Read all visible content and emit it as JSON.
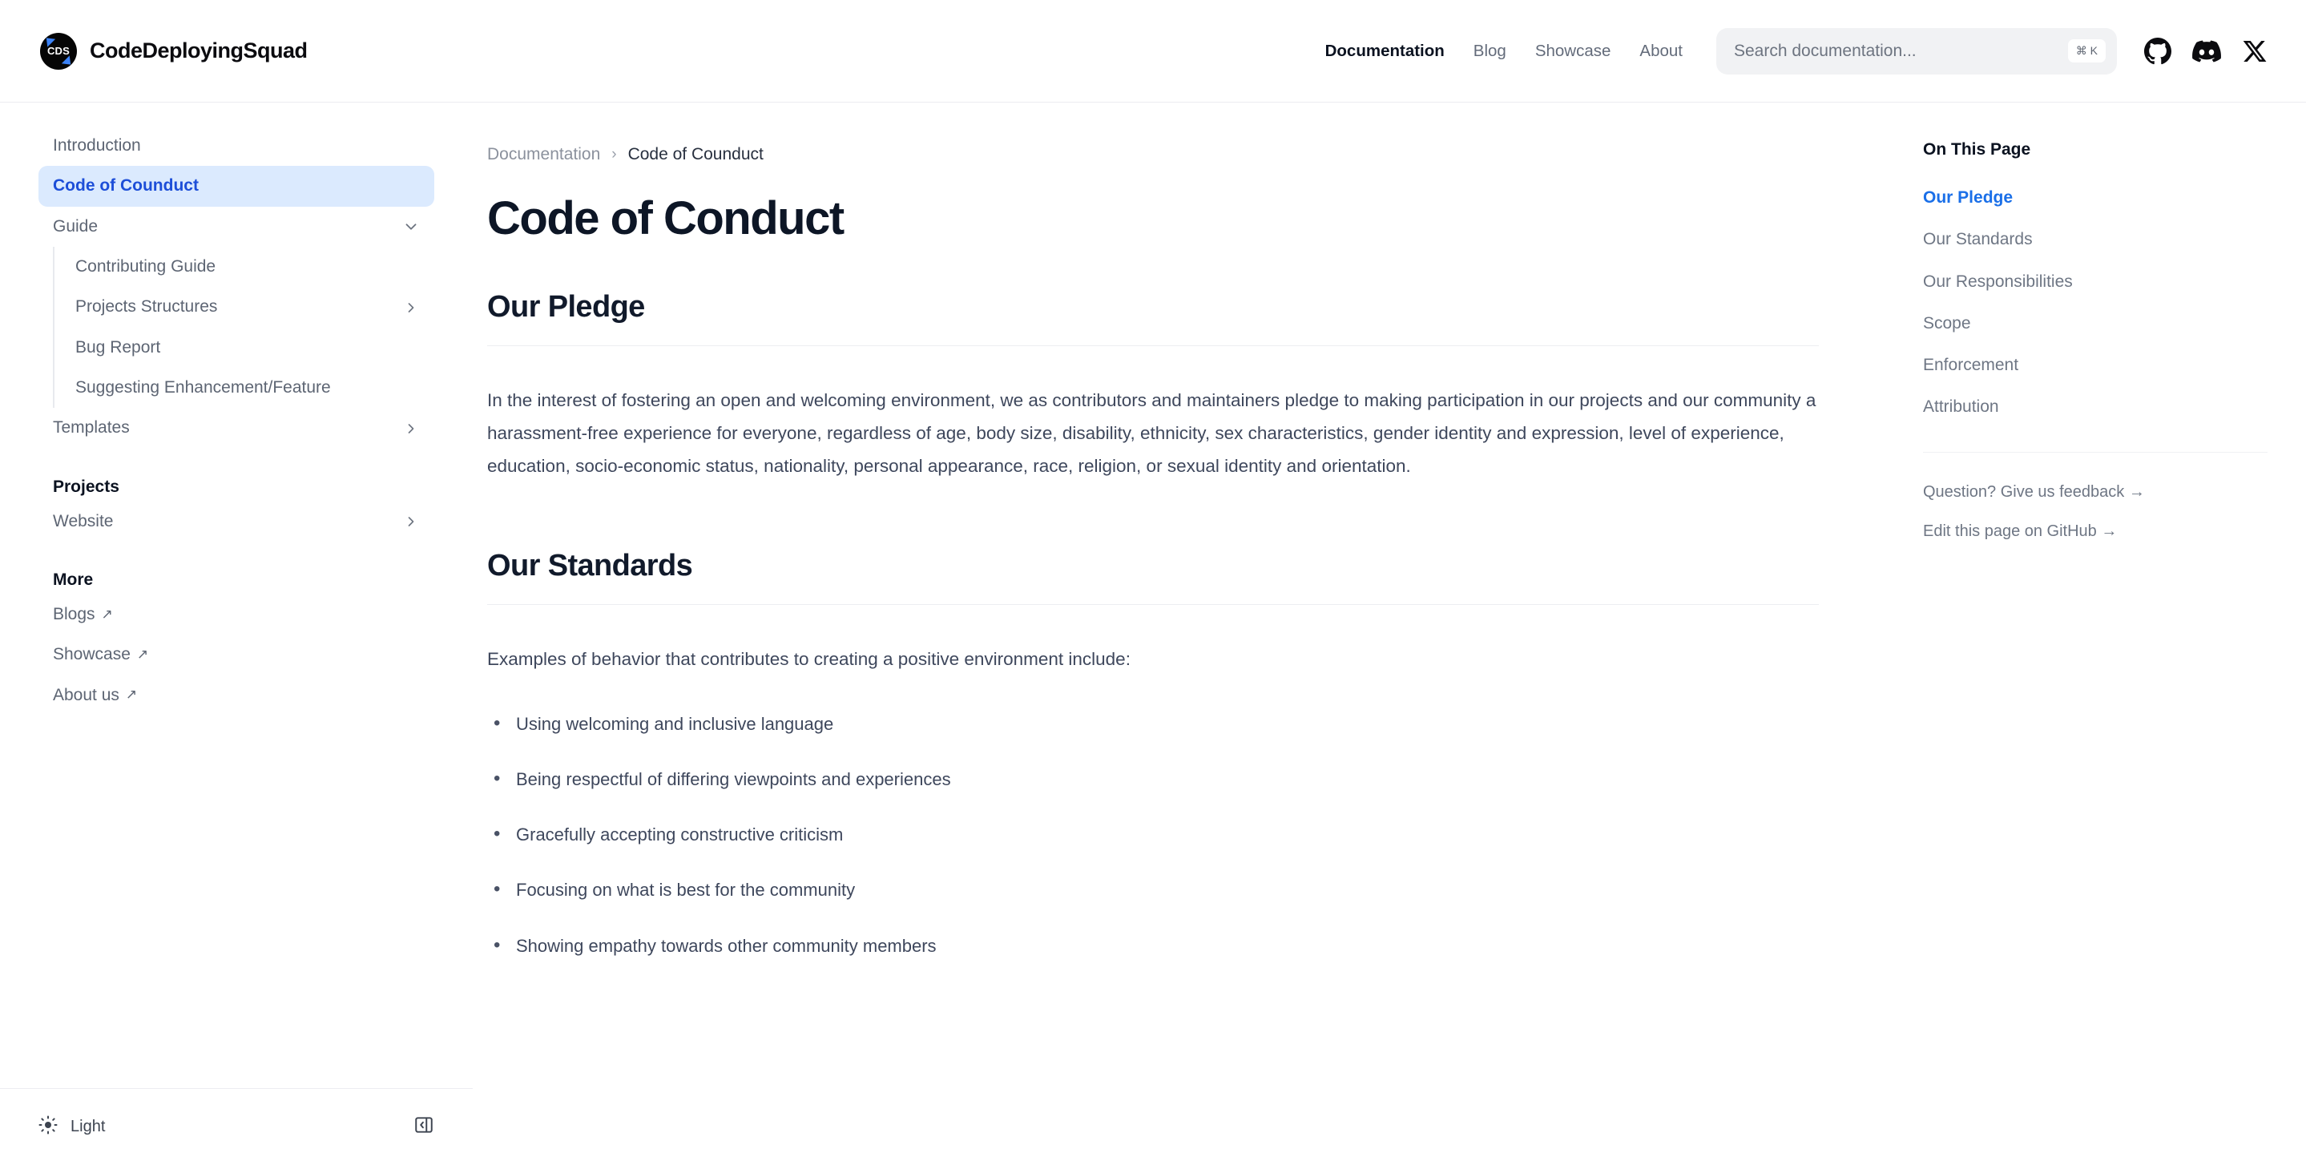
{
  "header": {
    "brand": {
      "logo_text": "CDS",
      "name": "CodeDeployingSquad"
    },
    "nav": [
      {
        "label": "Documentation",
        "active": true
      },
      {
        "label": "Blog",
        "active": false
      },
      {
        "label": "Showcase",
        "active": false
      },
      {
        "label": "About",
        "active": false
      }
    ],
    "search": {
      "placeholder": "Search documentation...",
      "value": "",
      "shortcut": "⌘ K"
    },
    "social": [
      {
        "name": "github-icon",
        "label": "GitHub"
      },
      {
        "name": "discord-icon",
        "label": "Discord"
      },
      {
        "name": "x-icon",
        "label": "X"
      }
    ]
  },
  "sidebar": {
    "items": [
      {
        "label": "Introduction"
      },
      {
        "label": "Code of Counduct"
      },
      {
        "label": "Guide"
      },
      {
        "label": "Contributing Guide"
      },
      {
        "label": "Projects Structures"
      },
      {
        "label": "Bug Report"
      },
      {
        "label": "Suggesting Enhancement/Feature"
      },
      {
        "label": "Templates"
      }
    ],
    "section_projects": {
      "title": "Projects",
      "items": [
        {
          "label": "Website"
        }
      ]
    },
    "section_more": {
      "title": "More",
      "items": [
        {
          "label": "Blogs",
          "external": true
        },
        {
          "label": "Showcase",
          "external": true
        },
        {
          "label": "About us",
          "external": true
        }
      ]
    },
    "external_arrow": "↗",
    "footer": {
      "theme_label": "Light",
      "theme_icon": "sun-icon",
      "collapse_icon": "sidebar-collapse-icon"
    }
  },
  "breadcrumb": {
    "root": "Documentation",
    "separator": "›",
    "current": "Code of Counduct"
  },
  "page": {
    "title": "Code of Conduct",
    "sections": [
      {
        "heading": "Our Pledge",
        "paragraph": "In the interest of fostering an open and welcoming environment, we as contributors and maintainers pledge to making participation in our projects and our community a harassment-free experience for everyone, regardless of age, body size, disability, ethnicity, sex characteristics, gender identity and expression, level of experience, education, socio-economic status, nationality, personal appearance, race, religion, or sexual identity and orientation."
      },
      {
        "heading": "Our Standards",
        "paragraph": "Examples of behavior that contributes to creating a positive environment include:",
        "bullets": [
          "Using welcoming and inclusive language",
          "Being respectful of differing viewpoints and experiences",
          "Gracefully accepting constructive criticism",
          "Focusing on what is best for the community",
          "Showing empathy towards other community members"
        ]
      }
    ]
  },
  "toc": {
    "title": "On This Page",
    "items": [
      {
        "label": "Our Pledge",
        "active": true
      },
      {
        "label": "Our Standards",
        "active": false
      },
      {
        "label": "Our Responsibilities",
        "active": false
      },
      {
        "label": "Scope",
        "active": false
      },
      {
        "label": "Enforcement",
        "active": false
      },
      {
        "label": "Attribution",
        "active": false
      }
    ],
    "links": [
      {
        "label": "Question? Give us feedback →"
      },
      {
        "label": "Edit this page on GitHub →"
      }
    ]
  },
  "colors": {
    "accent_blue": "#1a6fe8",
    "active_nav_bg": "#dbeafe",
    "active_nav_text": "#1d4ed8",
    "body_text": "#3e475c",
    "muted_text": "#6e7684"
  }
}
